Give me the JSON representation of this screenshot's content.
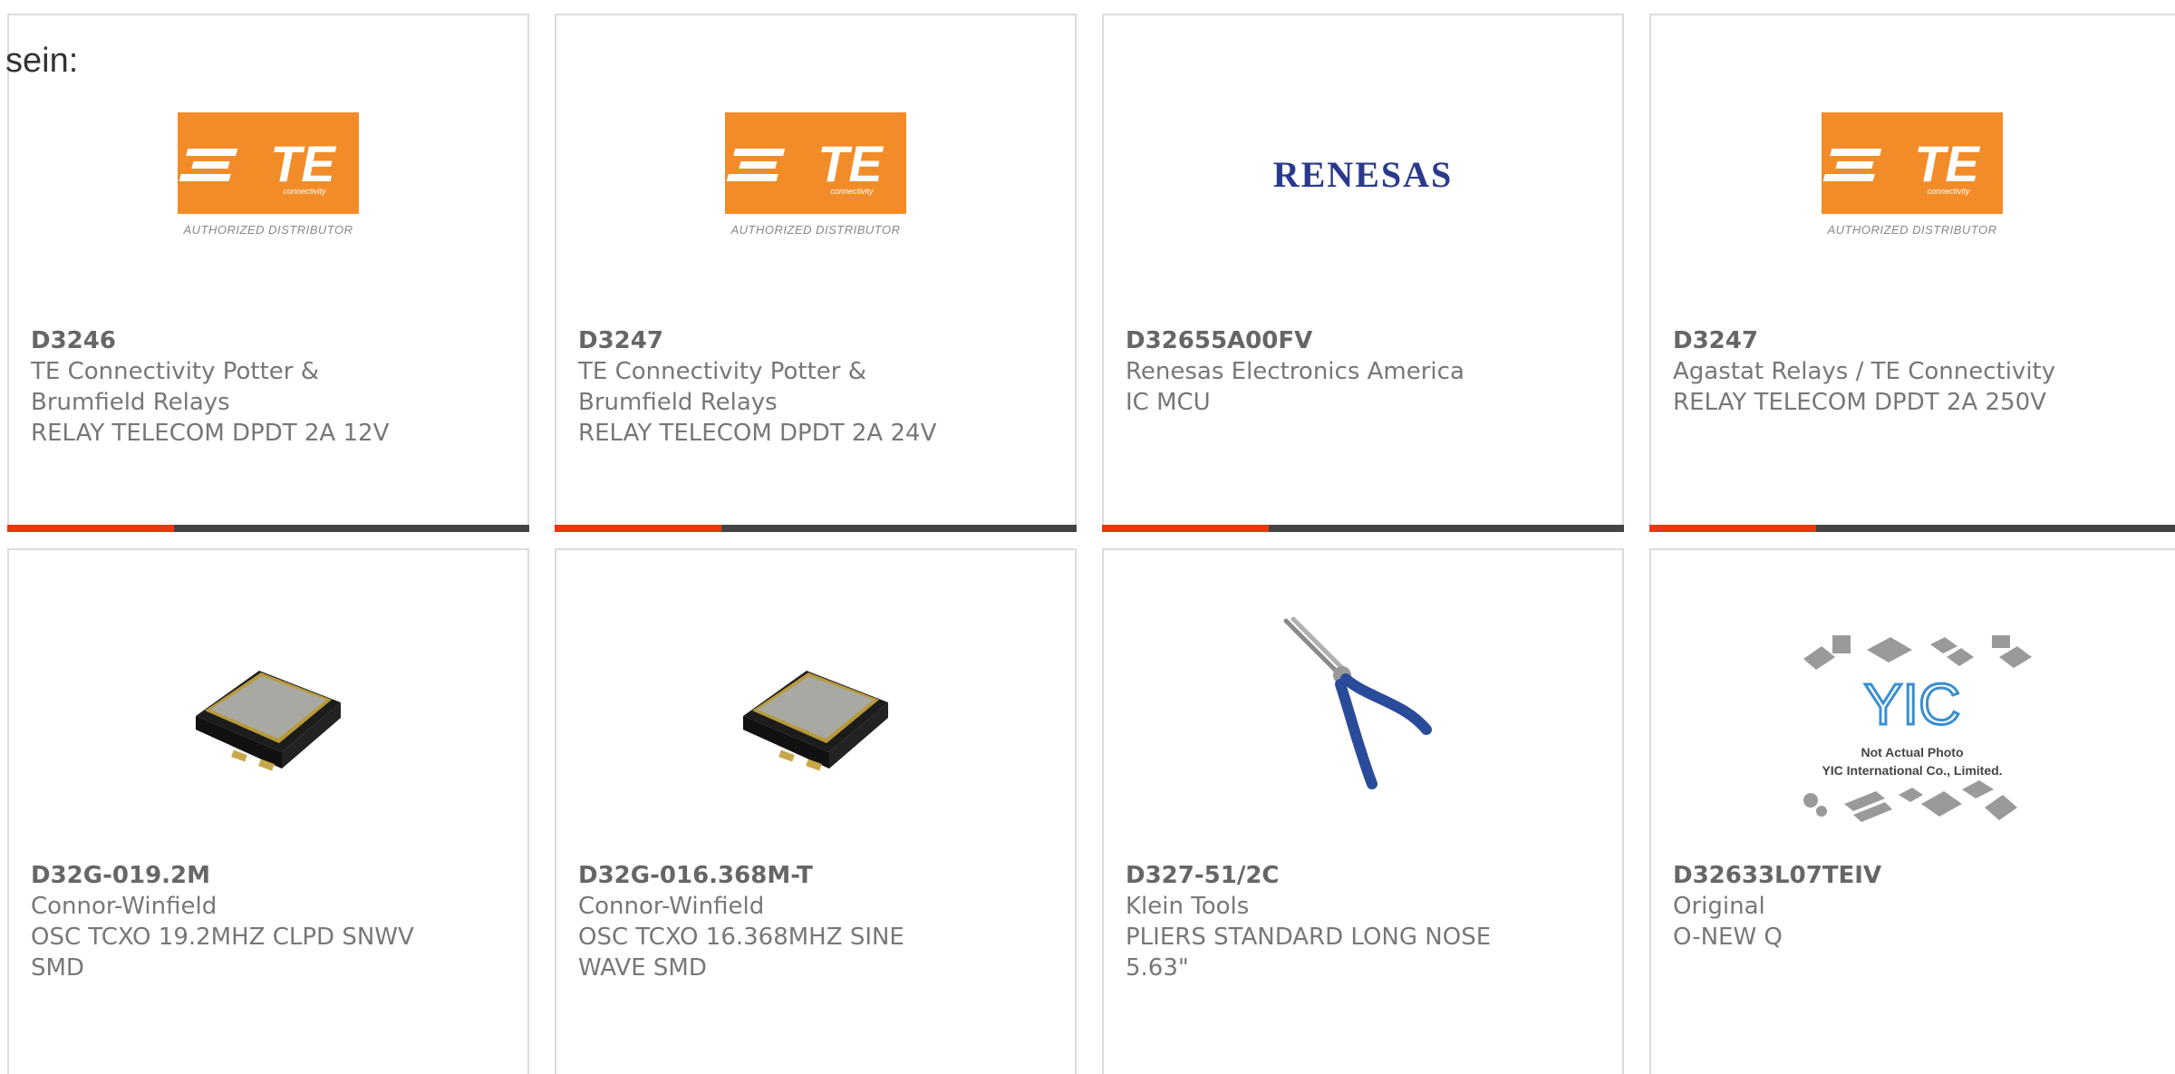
{
  "lead_text": "sein:",
  "colors": {
    "accent": "#e8380d",
    "bar": "#444444",
    "te_orange": "#f28c28",
    "renesas_blue": "#2a3a8c"
  },
  "te_logo": {
    "wordmark": "TE",
    "tagline": "connectivity",
    "caption": "AUTHORIZED DISTRIBUTOR"
  },
  "renesas_logo": {
    "wordmark": "RENESAS"
  },
  "yic_logo": {
    "caption1": "Not Actual Photo",
    "caption2": "YIC International Co., Limited."
  },
  "products": [
    {
      "part": "D3246",
      "lines": [
        "TE Connectivity Potter &",
        "Brumfield Relays",
        "RELAY TELECOM DPDT 2A 12V"
      ],
      "image": "te-logo"
    },
    {
      "part": "D3247",
      "lines": [
        "TE Connectivity Potter &",
        "Brumfield Relays",
        "RELAY TELECOM DPDT 2A 24V"
      ],
      "image": "te-logo"
    },
    {
      "part": "D32655A00FV",
      "lines": [
        "Renesas Electronics America",
        "IC MCU"
      ],
      "image": "renesas-logo"
    },
    {
      "part": "D3247",
      "lines": [
        "Agastat Relays / TE Connectivity",
        "RELAY TELECOM DPDT 2A 250V"
      ],
      "image": "te-logo"
    },
    {
      "part": "D32G-019.2M",
      "lines": [
        "Connor-Winfield",
        "OSC TCXO 19.2MHZ CLPD SNWV",
        "SMD"
      ],
      "image": "oscillator-photo"
    },
    {
      "part": "D32G-016.368M-T",
      "lines": [
        "Connor-Winfield",
        "OSC TCXO 16.368MHZ SINE",
        "WAVE SMD"
      ],
      "image": "oscillator-photo"
    },
    {
      "part": "D327-51/2C",
      "lines": [
        "Klein Tools",
        "PLIERS STANDARD LONG NOSE",
        "5.63\""
      ],
      "image": "pliers-photo"
    },
    {
      "part": "D32633L07TEIV",
      "lines": [
        "Original",
        "O-NEW Q"
      ],
      "image": "yic-placeholder"
    }
  ]
}
